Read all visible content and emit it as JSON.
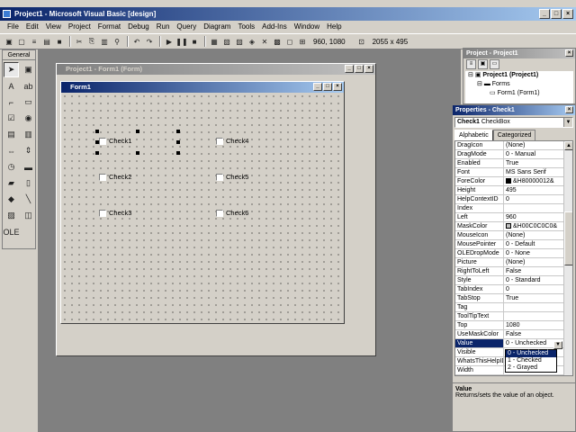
{
  "title": "Project1 - Microsoft Visual Basic [design]",
  "window_buttons": [
    "_",
    "□",
    "×"
  ],
  "menu": [
    "File",
    "Edit",
    "View",
    "Project",
    "Format",
    "Debug",
    "Run",
    "Query",
    "Diagram",
    "Tools",
    "Add-Ins",
    "Window",
    "Help"
  ],
  "toolbar": {
    "position": "960, 1080",
    "size": "2055 x 495"
  },
  "toolbox": {
    "tab": "General"
  },
  "project_form_window": {
    "title": "Project1 - Form1 (Form)"
  },
  "form1": {
    "title": "Form1",
    "checkboxes": [
      "Check1",
      "Check2",
      "Check3",
      "Check4",
      "Check5",
      "Check6"
    ]
  },
  "project_panel": {
    "title": "Project - Project1",
    "tree": [
      "Project1 (Project1)",
      "Forms",
      "Form1 (Form1)"
    ]
  },
  "properties": {
    "title": "Properties - Check1",
    "object_name": "Check1",
    "object_type": "CheckBox",
    "tabs": [
      "Alphabetic",
      "Categorized"
    ],
    "rows": [
      {
        "name": "DragIcon",
        "value": "(None)"
      },
      {
        "name": "DragMode",
        "value": "0 - Manual"
      },
      {
        "name": "Enabled",
        "value": "True"
      },
      {
        "name": "Font",
        "value": "MS Sans Serif"
      },
      {
        "name": "ForeColor",
        "value": "&H80000012&",
        "color": "#000000"
      },
      {
        "name": "Height",
        "value": "495"
      },
      {
        "name": "HelpContextID",
        "value": "0"
      },
      {
        "name": "Index",
        "value": ""
      },
      {
        "name": "Left",
        "value": "960"
      },
      {
        "name": "MaskColor",
        "value": "&H00C0C0C0&",
        "color": "#c0c0c0"
      },
      {
        "name": "MouseIcon",
        "value": "(None)"
      },
      {
        "name": "MousePointer",
        "value": "0 - Default"
      },
      {
        "name": "OLEDropMode",
        "value": "0 - None"
      },
      {
        "name": "Picture",
        "value": "(None)"
      },
      {
        "name": "RightToLeft",
        "value": "False"
      },
      {
        "name": "Style",
        "value": "0 - Standard"
      },
      {
        "name": "TabIndex",
        "value": "0"
      },
      {
        "name": "TabStop",
        "value": "True"
      },
      {
        "name": "Tag",
        "value": ""
      },
      {
        "name": "ToolTipText",
        "value": ""
      },
      {
        "name": "Top",
        "value": "1080"
      },
      {
        "name": "UseMaskColor",
        "value": "False"
      },
      {
        "name": "Value",
        "value": "0 - Unchecked"
      },
      {
        "name": "Visible",
        "value": ""
      },
      {
        "name": "WhatsThisHelpID",
        "value": ""
      },
      {
        "name": "Width",
        "value": "2055"
      }
    ],
    "dropdown_options": [
      "0 - Unchecked",
      "1 - Checked",
      "2 - Grayed"
    ],
    "description_title": "Value",
    "description_text": "Returns/sets the value of an object."
  }
}
